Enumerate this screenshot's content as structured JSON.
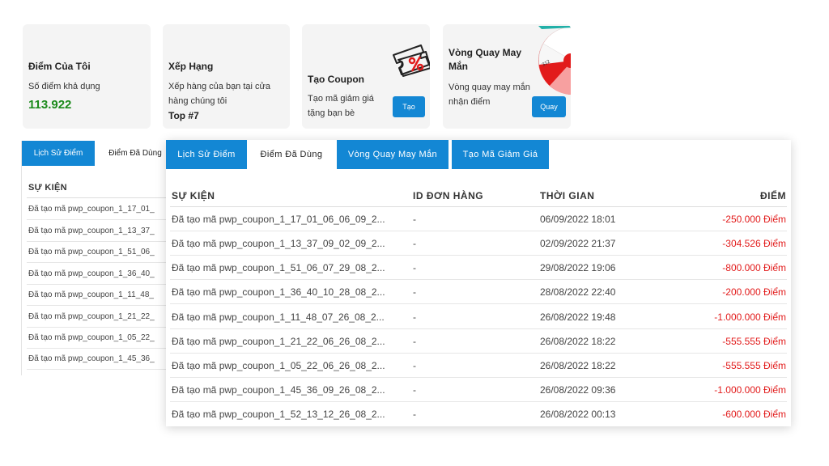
{
  "cards": {
    "points": {
      "title": "Điểm Của Tôi",
      "label": "Số điểm khả dụng",
      "value": "113.922"
    },
    "rank": {
      "title": "Xếp Hạng",
      "text": "Xếp hàng của bạn tại cửa hàng chúng tôi",
      "value": "Top #7"
    },
    "coupon": {
      "title": "Tạo Coupon",
      "text": "Tạo mã giảm giá tặng bạn bè",
      "button": "Tạo"
    },
    "wheel": {
      "title": "Vòng Quay May Mắn",
      "text": "Vòng quay may mắn nhận điểm",
      "button": "Quay"
    }
  },
  "back_panel": {
    "tabs": [
      "Lịch Sử Điểm",
      "Điểm Đã Dùng"
    ],
    "header": "SỰ KIỆN",
    "rows": [
      "Đã tạo mã pwp_coupon_1_17_01_",
      "Đã tạo mã pwp_coupon_1_13_37_",
      "Đã tạo mã pwp_coupon_1_51_06_",
      "Đã tạo mã pwp_coupon_1_36_40_",
      "Đã tạo mã pwp_coupon_1_11_48_",
      "Đã tạo mã pwp_coupon_1_21_22_",
      "Đã tạo mã pwp_coupon_1_05_22_",
      "Đã tạo mã pwp_coupon_1_45_36_"
    ]
  },
  "front_panel": {
    "tabs": [
      "Lịch Sử Điểm",
      "Điểm Đã Dùng",
      "Vòng Quay May Mắn",
      "Tạo Mã Giảm Giá"
    ],
    "columns": [
      "SỰ KIỆN",
      "ID ĐƠN HÀNG",
      "THỜI GIAN",
      "ĐIỂM"
    ],
    "rows": [
      {
        "event": "Đã tạo mã pwp_coupon_1_17_01_06_06_09_2...",
        "order": "-",
        "time": "06/09/2022 18:01",
        "points": "-250.000 Điểm"
      },
      {
        "event": "Đã tạo mã pwp_coupon_1_13_37_09_02_09_2...",
        "order": "-",
        "time": "02/09/2022 21:37",
        "points": "-304.526 Điểm"
      },
      {
        "event": "Đã tạo mã pwp_coupon_1_51_06_07_29_08_2...",
        "order": "-",
        "time": "29/08/2022 19:06",
        "points": "-800.000 Điểm"
      },
      {
        "event": "Đã tạo mã pwp_coupon_1_36_40_10_28_08_2...",
        "order": "-",
        "time": "28/08/2022 22:40",
        "points": "-200.000 Điểm"
      },
      {
        "event": "Đã tạo mã pwp_coupon_1_11_48_07_26_08_2...",
        "order": "-",
        "time": "26/08/2022 19:48",
        "points": "-1.000.000 Điểm"
      },
      {
        "event": "Đã tạo mã pwp_coupon_1_21_22_06_26_08_2...",
        "order": "-",
        "time": "26/08/2022 18:22",
        "points": "-555.555 Điểm"
      },
      {
        "event": "Đã tạo mã pwp_coupon_1_05_22_06_26_08_2...",
        "order": "-",
        "time": "26/08/2022 18:22",
        "points": "-555.555 Điểm"
      },
      {
        "event": "Đã tạo mã pwp_coupon_1_45_36_09_26_08_2...",
        "order": "-",
        "time": "26/08/2022 09:36",
        "points": "-1.000.000 Điểm"
      },
      {
        "event": "Đã tạo mã pwp_coupon_1_52_13_12_26_08_2...",
        "order": "-",
        "time": "26/08/2022 00:13",
        "points": "-600.000 Điểm"
      }
    ]
  },
  "colors": {
    "accent": "#1387d4",
    "points_green": "#1b8a1b",
    "negative_red": "#e21b1b",
    "card_bg": "#f4f4f4"
  },
  "icons": {
    "coupon": "coupon-percent-icon",
    "wheel": "lucky-wheel-icon"
  }
}
